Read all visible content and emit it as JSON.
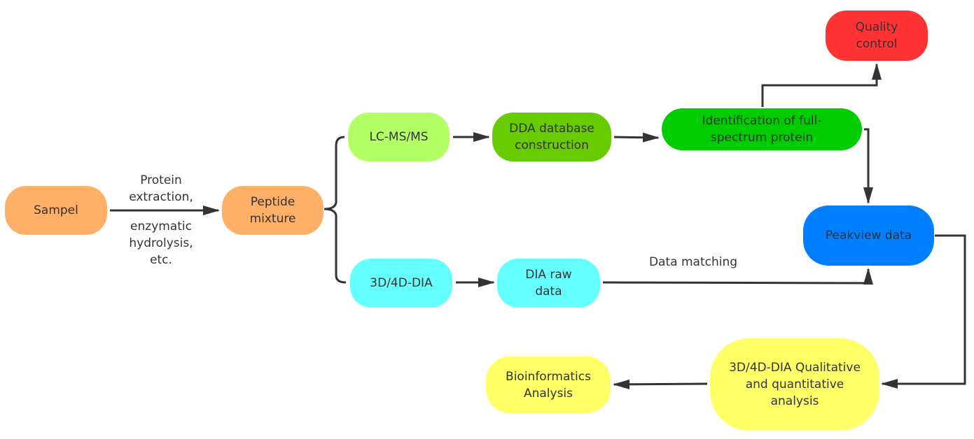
{
  "nodes": {
    "sample": {
      "label": "Sampel",
      "color": "#FFB066"
    },
    "peptide": {
      "label": "Peptide mixture",
      "color": "#FFB066"
    },
    "lcms": {
      "label": "LC-MS/MS",
      "color": "#B3FF66"
    },
    "dda": {
      "label": "DDA database construction",
      "color": "#66CC00"
    },
    "identification": {
      "label": "Identification of full-spectrum protein",
      "color": "#00CC00"
    },
    "quality": {
      "label": "Quality control",
      "color": "#FF3333"
    },
    "peakview": {
      "label": "Peakview data",
      "color": "#0080FF"
    },
    "dia": {
      "label": "3D/4D-DIA",
      "color": "#66FFFF"
    },
    "diaraw": {
      "label": "DIA raw data",
      "color": "#66FFFF"
    },
    "analysis": {
      "label": "3D/4D-DIA Qualitative and quantitative analysis",
      "color": "#FFFF66"
    },
    "bioinfo": {
      "label": "Bioinformatics Analysis",
      "color": "#FFFF66"
    }
  },
  "edge_labels": {
    "extraction_top": "Protein extraction,",
    "extraction_bottom": "enzymatic hydrolysis, etc.",
    "matching": "Data matching"
  },
  "line_color": "#333333"
}
